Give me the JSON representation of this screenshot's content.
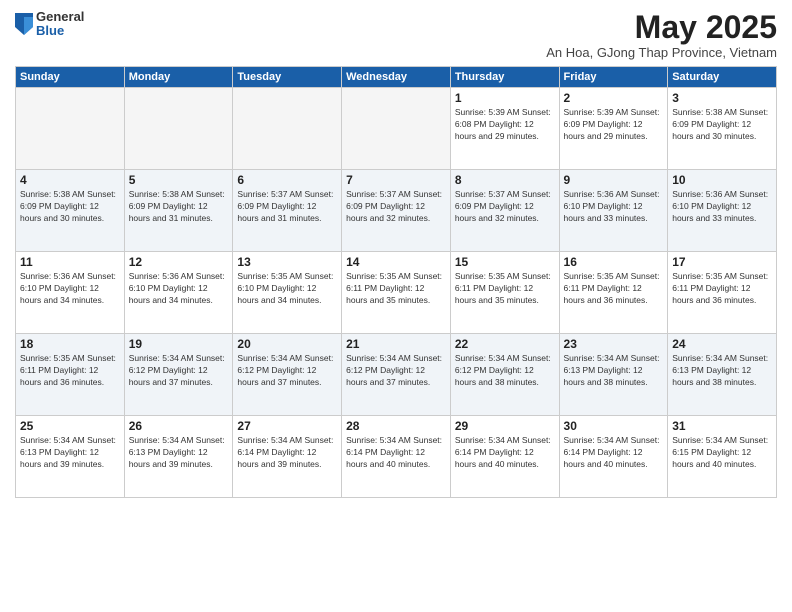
{
  "logo": {
    "general": "General",
    "blue": "Blue"
  },
  "title": "May 2025",
  "location": "An Hoa, GJong Thap Province, Vietnam",
  "days_of_week": [
    "Sunday",
    "Monday",
    "Tuesday",
    "Wednesday",
    "Thursday",
    "Friday",
    "Saturday"
  ],
  "weeks": [
    [
      {
        "day": "",
        "empty": true
      },
      {
        "day": "",
        "empty": true
      },
      {
        "day": "",
        "empty": true
      },
      {
        "day": "",
        "empty": true
      },
      {
        "day": "1",
        "info": "Sunrise: 5:39 AM\nSunset: 6:08 PM\nDaylight: 12 hours\nand 29 minutes."
      },
      {
        "day": "2",
        "info": "Sunrise: 5:39 AM\nSunset: 6:09 PM\nDaylight: 12 hours\nand 29 minutes."
      },
      {
        "day": "3",
        "info": "Sunrise: 5:38 AM\nSunset: 6:09 PM\nDaylight: 12 hours\nand 30 minutes."
      }
    ],
    [
      {
        "day": "4",
        "info": "Sunrise: 5:38 AM\nSunset: 6:09 PM\nDaylight: 12 hours\nand 30 minutes."
      },
      {
        "day": "5",
        "info": "Sunrise: 5:38 AM\nSunset: 6:09 PM\nDaylight: 12 hours\nand 31 minutes."
      },
      {
        "day": "6",
        "info": "Sunrise: 5:37 AM\nSunset: 6:09 PM\nDaylight: 12 hours\nand 31 minutes."
      },
      {
        "day": "7",
        "info": "Sunrise: 5:37 AM\nSunset: 6:09 PM\nDaylight: 12 hours\nand 32 minutes."
      },
      {
        "day": "8",
        "info": "Sunrise: 5:37 AM\nSunset: 6:09 PM\nDaylight: 12 hours\nand 32 minutes."
      },
      {
        "day": "9",
        "info": "Sunrise: 5:36 AM\nSunset: 6:10 PM\nDaylight: 12 hours\nand 33 minutes."
      },
      {
        "day": "10",
        "info": "Sunrise: 5:36 AM\nSunset: 6:10 PM\nDaylight: 12 hours\nand 33 minutes."
      }
    ],
    [
      {
        "day": "11",
        "info": "Sunrise: 5:36 AM\nSunset: 6:10 PM\nDaylight: 12 hours\nand 34 minutes."
      },
      {
        "day": "12",
        "info": "Sunrise: 5:36 AM\nSunset: 6:10 PM\nDaylight: 12 hours\nand 34 minutes."
      },
      {
        "day": "13",
        "info": "Sunrise: 5:35 AM\nSunset: 6:10 PM\nDaylight: 12 hours\nand 34 minutes."
      },
      {
        "day": "14",
        "info": "Sunrise: 5:35 AM\nSunset: 6:11 PM\nDaylight: 12 hours\nand 35 minutes."
      },
      {
        "day": "15",
        "info": "Sunrise: 5:35 AM\nSunset: 6:11 PM\nDaylight: 12 hours\nand 35 minutes."
      },
      {
        "day": "16",
        "info": "Sunrise: 5:35 AM\nSunset: 6:11 PM\nDaylight: 12 hours\nand 36 minutes."
      },
      {
        "day": "17",
        "info": "Sunrise: 5:35 AM\nSunset: 6:11 PM\nDaylight: 12 hours\nand 36 minutes."
      }
    ],
    [
      {
        "day": "18",
        "info": "Sunrise: 5:35 AM\nSunset: 6:11 PM\nDaylight: 12 hours\nand 36 minutes."
      },
      {
        "day": "19",
        "info": "Sunrise: 5:34 AM\nSunset: 6:12 PM\nDaylight: 12 hours\nand 37 minutes."
      },
      {
        "day": "20",
        "info": "Sunrise: 5:34 AM\nSunset: 6:12 PM\nDaylight: 12 hours\nand 37 minutes."
      },
      {
        "day": "21",
        "info": "Sunrise: 5:34 AM\nSunset: 6:12 PM\nDaylight: 12 hours\nand 37 minutes."
      },
      {
        "day": "22",
        "info": "Sunrise: 5:34 AM\nSunset: 6:12 PM\nDaylight: 12 hours\nand 38 minutes."
      },
      {
        "day": "23",
        "info": "Sunrise: 5:34 AM\nSunset: 6:13 PM\nDaylight: 12 hours\nand 38 minutes."
      },
      {
        "day": "24",
        "info": "Sunrise: 5:34 AM\nSunset: 6:13 PM\nDaylight: 12 hours\nand 38 minutes."
      }
    ],
    [
      {
        "day": "25",
        "info": "Sunrise: 5:34 AM\nSunset: 6:13 PM\nDaylight: 12 hours\nand 39 minutes."
      },
      {
        "day": "26",
        "info": "Sunrise: 5:34 AM\nSunset: 6:13 PM\nDaylight: 12 hours\nand 39 minutes."
      },
      {
        "day": "27",
        "info": "Sunrise: 5:34 AM\nSunset: 6:14 PM\nDaylight: 12 hours\nand 39 minutes."
      },
      {
        "day": "28",
        "info": "Sunrise: 5:34 AM\nSunset: 6:14 PM\nDaylight: 12 hours\nand 40 minutes."
      },
      {
        "day": "29",
        "info": "Sunrise: 5:34 AM\nSunset: 6:14 PM\nDaylight: 12 hours\nand 40 minutes."
      },
      {
        "day": "30",
        "info": "Sunrise: 5:34 AM\nSunset: 6:14 PM\nDaylight: 12 hours\nand 40 minutes."
      },
      {
        "day": "31",
        "info": "Sunrise: 5:34 AM\nSunset: 6:15 PM\nDaylight: 12 hours\nand 40 minutes."
      }
    ]
  ]
}
